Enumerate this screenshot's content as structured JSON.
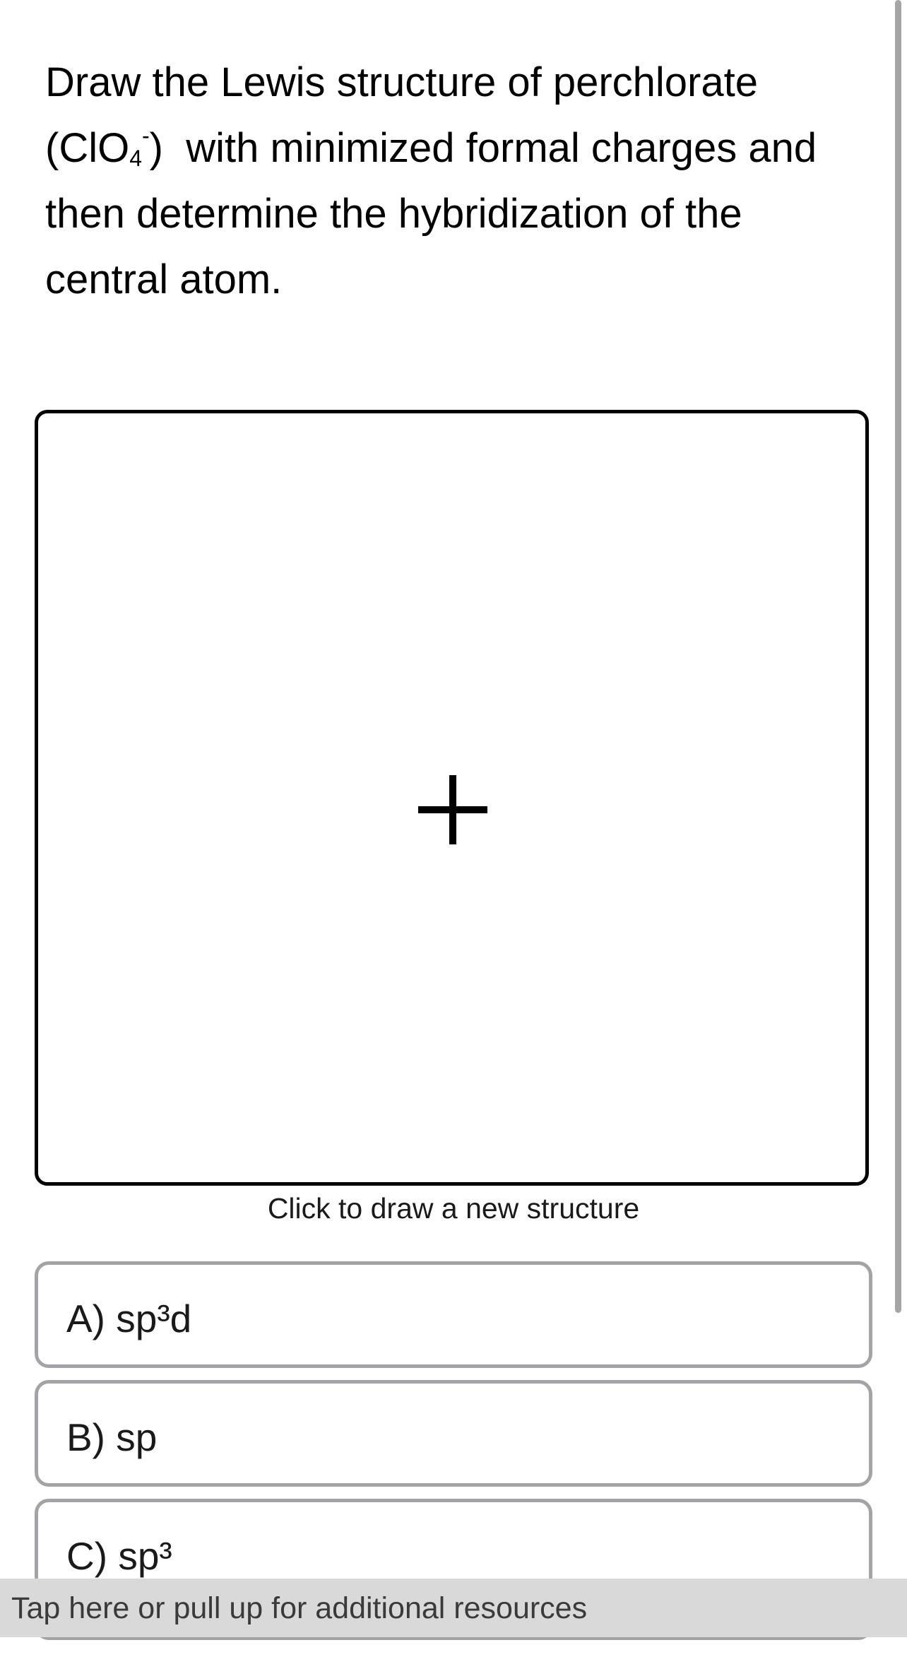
{
  "question": {
    "line1_part1": "Draw the Lewis structure of perchlorate",
    "formula_open": "(ClO",
    "formula_sub": "4",
    "formula_sup": "-",
    "formula_close": ")",
    "line2_rest": " with minimized formal charges and then determine the hybridization of the central atom."
  },
  "draw_area": {
    "icon": "plus-icon",
    "caption": "Click to draw a new structure"
  },
  "options": [
    {
      "label": "A) sp³d"
    },
    {
      "label": "B) sp"
    },
    {
      "label": "C) sp³"
    }
  ],
  "resources_bar": {
    "label": "Tap here or pull up for additional resources"
  },
  "colors": {
    "option_border": "#a3a3a8",
    "resources_bg": "#d9d9d9",
    "scrollbar": "#a6a6a6"
  }
}
